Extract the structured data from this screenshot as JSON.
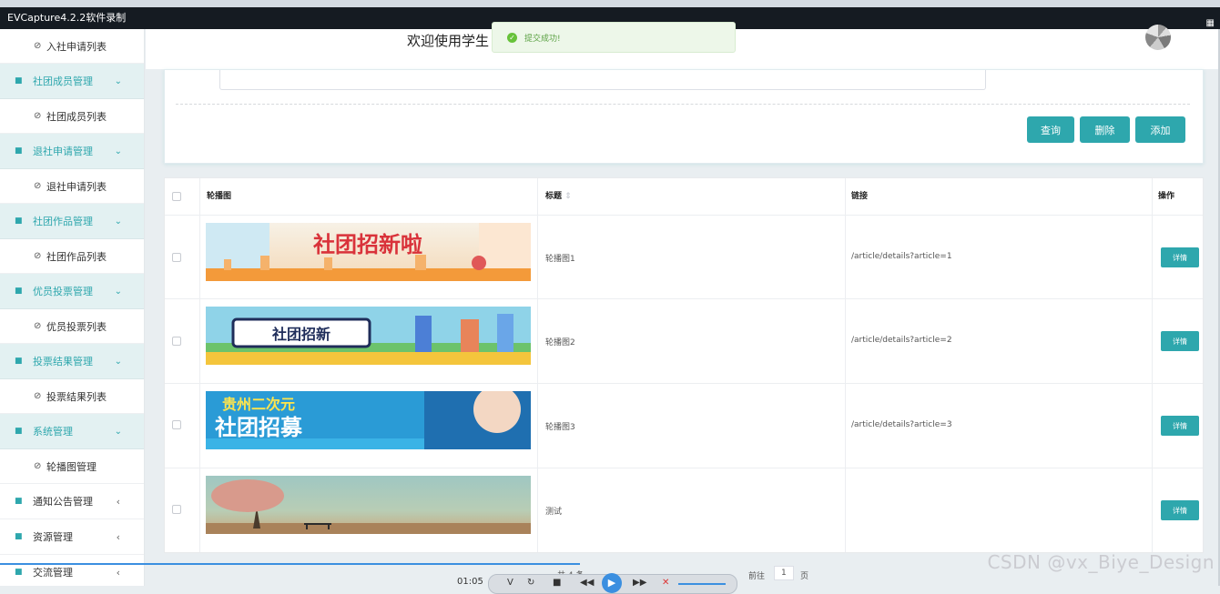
{
  "window": {
    "title": "EVCapture4.2.2软件录制"
  },
  "sidebar": {
    "items": [
      {
        "type": "item",
        "label": "入社申请列表"
      },
      {
        "type": "group",
        "label": "社团成员管理"
      },
      {
        "type": "item",
        "label": "社团成员列表"
      },
      {
        "type": "group",
        "label": "退社申请管理"
      },
      {
        "type": "item",
        "label": "退社申请列表"
      },
      {
        "type": "group",
        "label": "社团作品管理"
      },
      {
        "type": "item",
        "label": "社团作品列表"
      },
      {
        "type": "group",
        "label": "优员投票管理"
      },
      {
        "type": "item",
        "label": "优员投票列表"
      },
      {
        "type": "group",
        "label": "投票结果管理"
      },
      {
        "type": "item",
        "label": "投票结果列表"
      },
      {
        "type": "group",
        "label": "系统管理"
      },
      {
        "type": "item",
        "label": "轮播图管理"
      },
      {
        "type": "plain",
        "label": "通知公告管理"
      },
      {
        "type": "plain",
        "label": "资源管理"
      },
      {
        "type": "plain",
        "label": "交流管理"
      }
    ]
  },
  "header": {
    "welcome": "欢迎使用学生"
  },
  "toast": {
    "message": "提交成功!"
  },
  "actions": {
    "query": "查询",
    "delete": "删除",
    "add": "添加"
  },
  "table": {
    "columns": {
      "image": "轮播图",
      "title": "标题",
      "link": "链接",
      "ops": "操作"
    },
    "rows": [
      {
        "title": "轮播图1",
        "link": "/article/details?article=1",
        "action": "详情",
        "banner_text": "社团招新啦"
      },
      {
        "title": "轮播图2",
        "link": "/article/details?article=2",
        "action": "详情",
        "banner_text": "社团招新"
      },
      {
        "title": "轮播图3",
        "link": "/article/details?article=3",
        "action": "详情",
        "banner_text": "贵州二次元",
        "banner_text2": "社团招募"
      },
      {
        "title": "测试",
        "link": "",
        "action": "详情"
      }
    ]
  },
  "pager": {
    "total": "共 4 条",
    "goto": "前往",
    "page": "1",
    "page_unit": "页"
  },
  "player": {
    "time": "01:05"
  },
  "watermark": "CSDN @vx_Biye_Design",
  "colors": {
    "accent": "#2ea7ad",
    "success": "#67c23a"
  }
}
